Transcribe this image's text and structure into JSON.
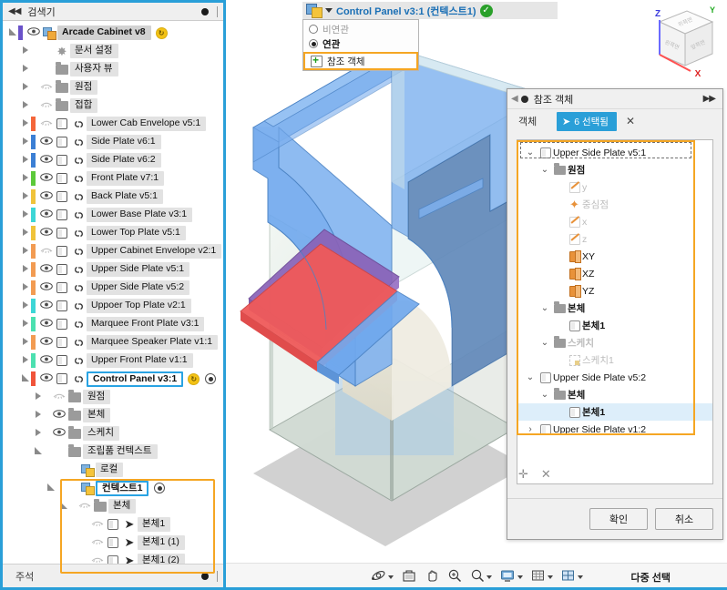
{
  "browser": {
    "header_title": "검색기",
    "footer_title": "주석",
    "collapse_icon": "double-left-arrow-icon",
    "tree": [
      {
        "indent": 0,
        "expander": "open",
        "swatch": "#6a52c9",
        "eye": "on",
        "icon": "assembly-icon",
        "label": "Arcade Cabinet v8",
        "style": "hl",
        "badge": "yellow"
      },
      {
        "indent": 1,
        "expander": "closed",
        "swatch": null,
        "eye": null,
        "icon": "gear-icon",
        "label": "문서 설정",
        "style": "plain"
      },
      {
        "indent": 1,
        "expander": "closed",
        "swatch": null,
        "eye": null,
        "icon": "folder-icon",
        "label": "사용자 뷰",
        "style": "plain"
      },
      {
        "indent": 1,
        "expander": "closed",
        "swatch": null,
        "eye": "off",
        "icon": "folder-icon",
        "label": "원점",
        "style": "plain"
      },
      {
        "indent": 1,
        "expander": "closed",
        "swatch": null,
        "eye": "off",
        "icon": "folder-icon",
        "label": "접합",
        "style": "plain"
      },
      {
        "indent": 1,
        "expander": "closed",
        "swatch": "#f4663a",
        "eye": "off",
        "icon": "component-icon",
        "link": true,
        "label": "Lower Cab Envelope v5:1",
        "style": "plain"
      },
      {
        "indent": 1,
        "expander": "closed",
        "swatch": "#3b7fd4",
        "eye": "on",
        "icon": "component-icon",
        "link": true,
        "label": "Side Plate v6:1",
        "style": "plain"
      },
      {
        "indent": 1,
        "expander": "closed",
        "swatch": "#3b7fd4",
        "eye": "on",
        "icon": "component-icon",
        "link": true,
        "label": "Side Plate v6:2",
        "style": "plain"
      },
      {
        "indent": 1,
        "expander": "closed",
        "swatch": "#5cc93a",
        "eye": "on",
        "icon": "component-icon",
        "link": true,
        "label": "Front Plate v7:1",
        "style": "plain"
      },
      {
        "indent": 1,
        "expander": "closed",
        "swatch": "#f0c33a",
        "eye": "on",
        "icon": "component-icon",
        "link": true,
        "label": "Back Plate v5:1",
        "style": "plain"
      },
      {
        "indent": 1,
        "expander": "closed",
        "swatch": "#3dd6d6",
        "eye": "on",
        "icon": "component-icon",
        "link": true,
        "label": "Lower Base Plate v3:1",
        "style": "plain"
      },
      {
        "indent": 1,
        "expander": "closed",
        "swatch": "#f0c33a",
        "eye": "on",
        "icon": "component-icon",
        "link": true,
        "label": "Lower Top Plate v5:1",
        "style": "plain"
      },
      {
        "indent": 1,
        "expander": "closed",
        "swatch": "#f29b52",
        "eye": "off",
        "icon": "component-icon",
        "link": true,
        "label": "Upper Cabinet Envelope v2:1",
        "style": "plain"
      },
      {
        "indent": 1,
        "expander": "closed",
        "swatch": "#f29b52",
        "eye": "on",
        "icon": "component-icon",
        "link": true,
        "label": "Upper Side Plate v5:1",
        "style": "plain"
      },
      {
        "indent": 1,
        "expander": "closed",
        "swatch": "#f29b52",
        "eye": "on",
        "icon": "component-icon",
        "link": true,
        "label": "Upper Side Plate v5:2",
        "style": "plain"
      },
      {
        "indent": 1,
        "expander": "closed",
        "swatch": "#3dd6d6",
        "eye": "on",
        "icon": "component-icon",
        "link": true,
        "label": "Uppoer Top Plate v2:1",
        "style": "plain"
      },
      {
        "indent": 1,
        "expander": "closed",
        "swatch": "#4ce0b0",
        "eye": "on",
        "icon": "component-icon",
        "link": true,
        "label": "Marquee Front Plate v3:1",
        "style": "plain"
      },
      {
        "indent": 1,
        "expander": "closed",
        "swatch": "#f29b52",
        "eye": "on",
        "icon": "component-icon",
        "link": true,
        "label": "Marquee Speaker Plate v1:1",
        "style": "plain"
      },
      {
        "indent": 1,
        "expander": "closed",
        "swatch": "#4ce0b0",
        "eye": "on",
        "icon": "component-icon",
        "link": true,
        "label": "Upper Front Plate v1:1",
        "style": "plain"
      },
      {
        "indent": 1,
        "expander": "open",
        "swatch": "#f0543a",
        "eye": "on",
        "icon": "component-icon",
        "link": true,
        "label": "Control Panel v3:1",
        "style": "sel",
        "badge": "yellow",
        "radio": true
      },
      {
        "indent": 2,
        "expander": "closed",
        "swatch": null,
        "eye": "off",
        "icon": "folder-icon",
        "label": "원점",
        "style": "plain"
      },
      {
        "indent": 2,
        "expander": "closed",
        "swatch": null,
        "eye": "on",
        "icon": "folder-icon",
        "label": "본체",
        "style": "plain"
      },
      {
        "indent": 2,
        "expander": "closed",
        "swatch": null,
        "eye": "on",
        "icon": "folder-icon",
        "label": "스케치",
        "style": "plain"
      },
      {
        "indent": 2,
        "expander": "open",
        "swatch": null,
        "eye": null,
        "icon": "folder-icon",
        "label": "조립품 컨텍스트",
        "style": "plain"
      },
      {
        "indent": 3,
        "expander": null,
        "swatch": null,
        "eye": null,
        "icon": "context-icon",
        "label": "로컬",
        "style": "plain"
      },
      {
        "indent": 3,
        "expander": "open",
        "swatch": null,
        "eye": null,
        "icon": "context-icon",
        "label": "컨텍스트1",
        "style": "sel",
        "radio": true
      },
      {
        "indent": 4,
        "expander": "open",
        "swatch": null,
        "eye": "off",
        "icon": "folder-icon",
        "label": "본체",
        "style": "plain"
      },
      {
        "indent": 5,
        "expander": null,
        "swatch": null,
        "eye": "off",
        "icon": "body-icon",
        "arrow": true,
        "label": "본체1",
        "style": "plain"
      },
      {
        "indent": 5,
        "expander": null,
        "swatch": null,
        "eye": "off",
        "icon": "body-icon",
        "arrow": true,
        "label": "본체1 (1)",
        "style": "plain"
      },
      {
        "indent": 5,
        "expander": null,
        "swatch": null,
        "eye": "off",
        "icon": "body-icon",
        "arrow": true,
        "label": "본체1 (2)",
        "style": "plain"
      }
    ]
  },
  "context_dropdown": {
    "icon": "assembly-context-icon",
    "caret": "chevron-down-icon",
    "title": "Control Panel v3:1 (컨텍스트1)",
    "status_icon": "check-circle-icon",
    "options": [
      {
        "label": "비연관",
        "selected": false
      },
      {
        "label": "연관",
        "selected": true
      }
    ],
    "reference_item": {
      "label": "참조 객체",
      "icon": "add-reference-icon"
    }
  },
  "dialog": {
    "title": "참조 객체",
    "expand_icon": "double-right-arrow-icon",
    "field_label": "객체",
    "select_button": "6 선택됨",
    "select_cursor_icon": "cursor-arrow-icon",
    "clear_icon": "close-icon",
    "add_icon": "plus-icon",
    "remove_icon": "close-icon",
    "ok_label": "확인",
    "cancel_label": "취소",
    "tree": [
      {
        "indent": 0,
        "chev": "down",
        "icon": "component-icon",
        "label": "Upper Side Plate v5:1",
        "dim": false,
        "selected": false
      },
      {
        "indent": 1,
        "chev": "down",
        "icon": "folder-icon",
        "label": "원점",
        "dim": false,
        "selected": false
      },
      {
        "indent": 2,
        "chev": "none",
        "icon": "axis-icon",
        "label": "y",
        "dim": true,
        "selected": false
      },
      {
        "indent": 2,
        "chev": "none",
        "icon": "point-icon",
        "label": "중심점",
        "dim": true,
        "selected": false
      },
      {
        "indent": 2,
        "chev": "none",
        "icon": "axis-icon",
        "label": "x",
        "dim": true,
        "selected": false
      },
      {
        "indent": 2,
        "chev": "none",
        "icon": "axis-icon",
        "label": "z",
        "dim": true,
        "selected": false
      },
      {
        "indent": 2,
        "chev": "none",
        "icon": "plane-icon",
        "label": "XY",
        "dim": false,
        "selected": false
      },
      {
        "indent": 2,
        "chev": "none",
        "icon": "plane-icon",
        "label": "XZ",
        "dim": false,
        "selected": false
      },
      {
        "indent": 2,
        "chev": "none",
        "icon": "plane-icon",
        "label": "YZ",
        "dim": false,
        "selected": false
      },
      {
        "indent": 1,
        "chev": "down",
        "icon": "folder-icon",
        "label": "본체",
        "dim": false,
        "selected": false
      },
      {
        "indent": 2,
        "chev": "none",
        "icon": "body-icon",
        "label": "본체1",
        "dim": false,
        "selected": false
      },
      {
        "indent": 1,
        "chev": "down",
        "icon": "folder-icon",
        "label": "스케치",
        "dim": true,
        "selected": false
      },
      {
        "indent": 2,
        "chev": "none",
        "icon": "sketch-icon",
        "label": "스케치1",
        "dim": true,
        "selected": false
      },
      {
        "indent": 0,
        "chev": "down",
        "icon": "component-icon",
        "label": "Upper Side Plate v5:2",
        "dim": false,
        "selected": false
      },
      {
        "indent": 1,
        "chev": "down",
        "icon": "folder-icon",
        "label": "본체",
        "dim": false,
        "selected": false
      },
      {
        "indent": 2,
        "chev": "none",
        "icon": "body-icon",
        "label": "본체1",
        "dim": false,
        "selected": true
      },
      {
        "indent": 0,
        "chev": "right",
        "icon": "component-icon",
        "label": "Upper Side Plate v1:2",
        "dim": false,
        "selected": false
      }
    ]
  },
  "navbar": {
    "items": [
      {
        "name": "orbit-icon",
        "glyph": "⌖",
        "caret": true
      },
      {
        "name": "look-at-icon",
        "glyph": "▤",
        "caret": false
      },
      {
        "name": "pan-icon",
        "glyph": "✋",
        "caret": false
      },
      {
        "name": "zoom-window-icon",
        "glyph": "⌕",
        "caret": false
      },
      {
        "name": "zoom-icon",
        "glyph": "⌕",
        "caret": true
      },
      {
        "name": "display-settings-icon",
        "glyph": "▭",
        "caret": true
      },
      {
        "name": "grid-settings-icon",
        "glyph": "▦",
        "caret": true
      },
      {
        "name": "viewports-icon",
        "glyph": "◫",
        "caret": true
      }
    ],
    "status_text": "다중 선택"
  },
  "viewcube": {
    "axis_x": "X",
    "axis_y": "Y",
    "axis_z": "Z"
  },
  "colors": {
    "accent_blue": "#2a9fd8",
    "highlight_orange": "#f5a623",
    "selection_blue": "#29a3e3",
    "model_blue": "#6aa8ee",
    "model_red": "#f05a5a",
    "model_purple": "#8a63b8",
    "model_glass": "#d9e6dd"
  }
}
